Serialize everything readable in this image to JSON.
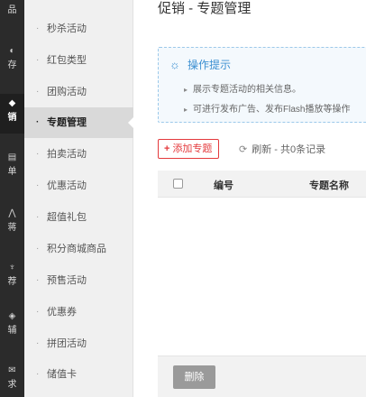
{
  "rail": {
    "items": [
      {
        "label": "品",
        "icon": "goods-icon",
        "glyph": "▭"
      },
      {
        "label": "存",
        "icon": "store-icon",
        "glyph": "◐"
      },
      {
        "label": "销",
        "icon": "promo-icon",
        "glyph": "◆"
      },
      {
        "label": "单",
        "icon": "order-icon",
        "glyph": "▤"
      },
      {
        "label": "蒋",
        "icon": "user-icon",
        "glyph": "⋀"
      },
      {
        "label": "荐",
        "icon": "recommend-icon",
        "glyph": "♆"
      },
      {
        "label": "辅",
        "icon": "assist-icon",
        "glyph": "◈"
      },
      {
        "label": "求",
        "icon": "request-icon",
        "glyph": "✉"
      }
    ]
  },
  "submenu": {
    "items": [
      {
        "label": "秒杀活动"
      },
      {
        "label": "红包类型"
      },
      {
        "label": "团购活动"
      },
      {
        "label": "专题管理",
        "active": true
      },
      {
        "label": "拍卖活动"
      },
      {
        "label": "优惠活动"
      },
      {
        "label": "超值礼包"
      },
      {
        "label": "积分商城商品"
      },
      {
        "label": "预售活动"
      },
      {
        "label": "优惠券"
      },
      {
        "label": "拼团活动"
      },
      {
        "label": "储值卡"
      }
    ]
  },
  "main": {
    "title": "促销 - 专题管理",
    "tips": {
      "heading": "操作提示",
      "lines": [
        "展示专题活动的相关信息。",
        "可进行发布广告、发布Flash播放等操作"
      ]
    },
    "toolbar": {
      "add_label": "添加专题",
      "refresh_label": "刷新 - 共0条记录"
    },
    "table": {
      "columns": [
        "编号",
        "专题名称"
      ]
    },
    "footer": {
      "delete_label": "删除"
    }
  },
  "colors": {
    "accent_red": "#e4393c",
    "tip_blue": "#3b8fd1",
    "rail_bg": "#2b2b2b"
  }
}
